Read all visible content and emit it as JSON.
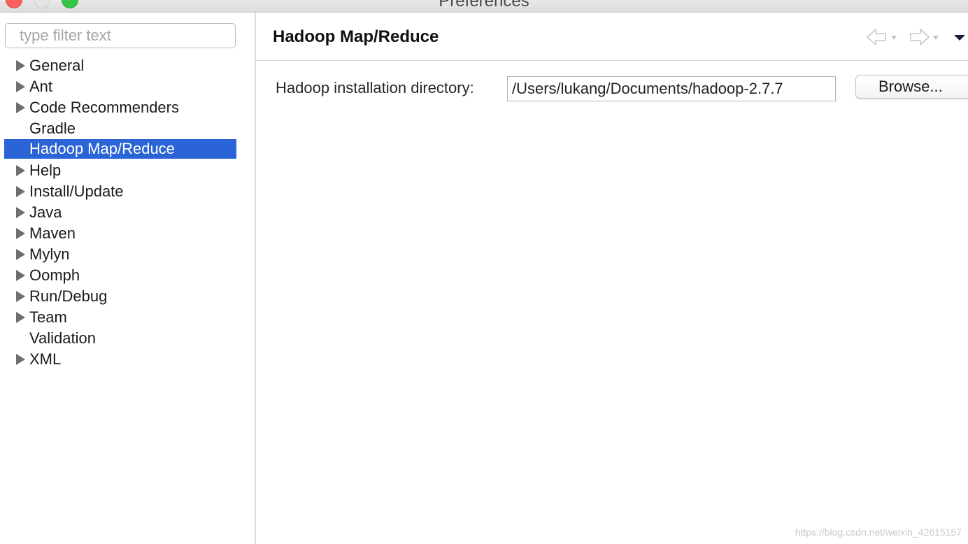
{
  "window": {
    "title": "Preferences"
  },
  "sidebar": {
    "filter_placeholder": "type filter text",
    "items": [
      {
        "label": "General",
        "expandable": true
      },
      {
        "label": "Ant",
        "expandable": true
      },
      {
        "label": "Code Recommenders",
        "expandable": true
      },
      {
        "label": "Gradle",
        "expandable": false
      },
      {
        "label": "Hadoop Map/Reduce",
        "expandable": false,
        "selected": true
      },
      {
        "label": "Help",
        "expandable": true
      },
      {
        "label": "Install/Update",
        "expandable": true
      },
      {
        "label": "Java",
        "expandable": true
      },
      {
        "label": "Maven",
        "expandable": true
      },
      {
        "label": "Mylyn",
        "expandable": true
      },
      {
        "label": "Oomph",
        "expandable": true
      },
      {
        "label": "Run/Debug",
        "expandable": true
      },
      {
        "label": "Team",
        "expandable": true
      },
      {
        "label": "Validation",
        "expandable": false
      },
      {
        "label": "XML",
        "expandable": true
      }
    ]
  },
  "page": {
    "title": "Hadoop Map/Reduce",
    "nav_icons": [
      "back-arrow-icon",
      "forward-arrow-icon",
      "view-menu-icon"
    ],
    "install_dir_label": "Hadoop installation directory:",
    "install_dir_value": "/Users/lukang/Documents/hadoop-2.7.7",
    "browse_label": "Browse..."
  },
  "watermark": "https://blog.csdn.net/weixin_42615157",
  "colors": {
    "selection": "#2a64d6",
    "close": "#fc605c",
    "maximize": "#34c84a"
  }
}
